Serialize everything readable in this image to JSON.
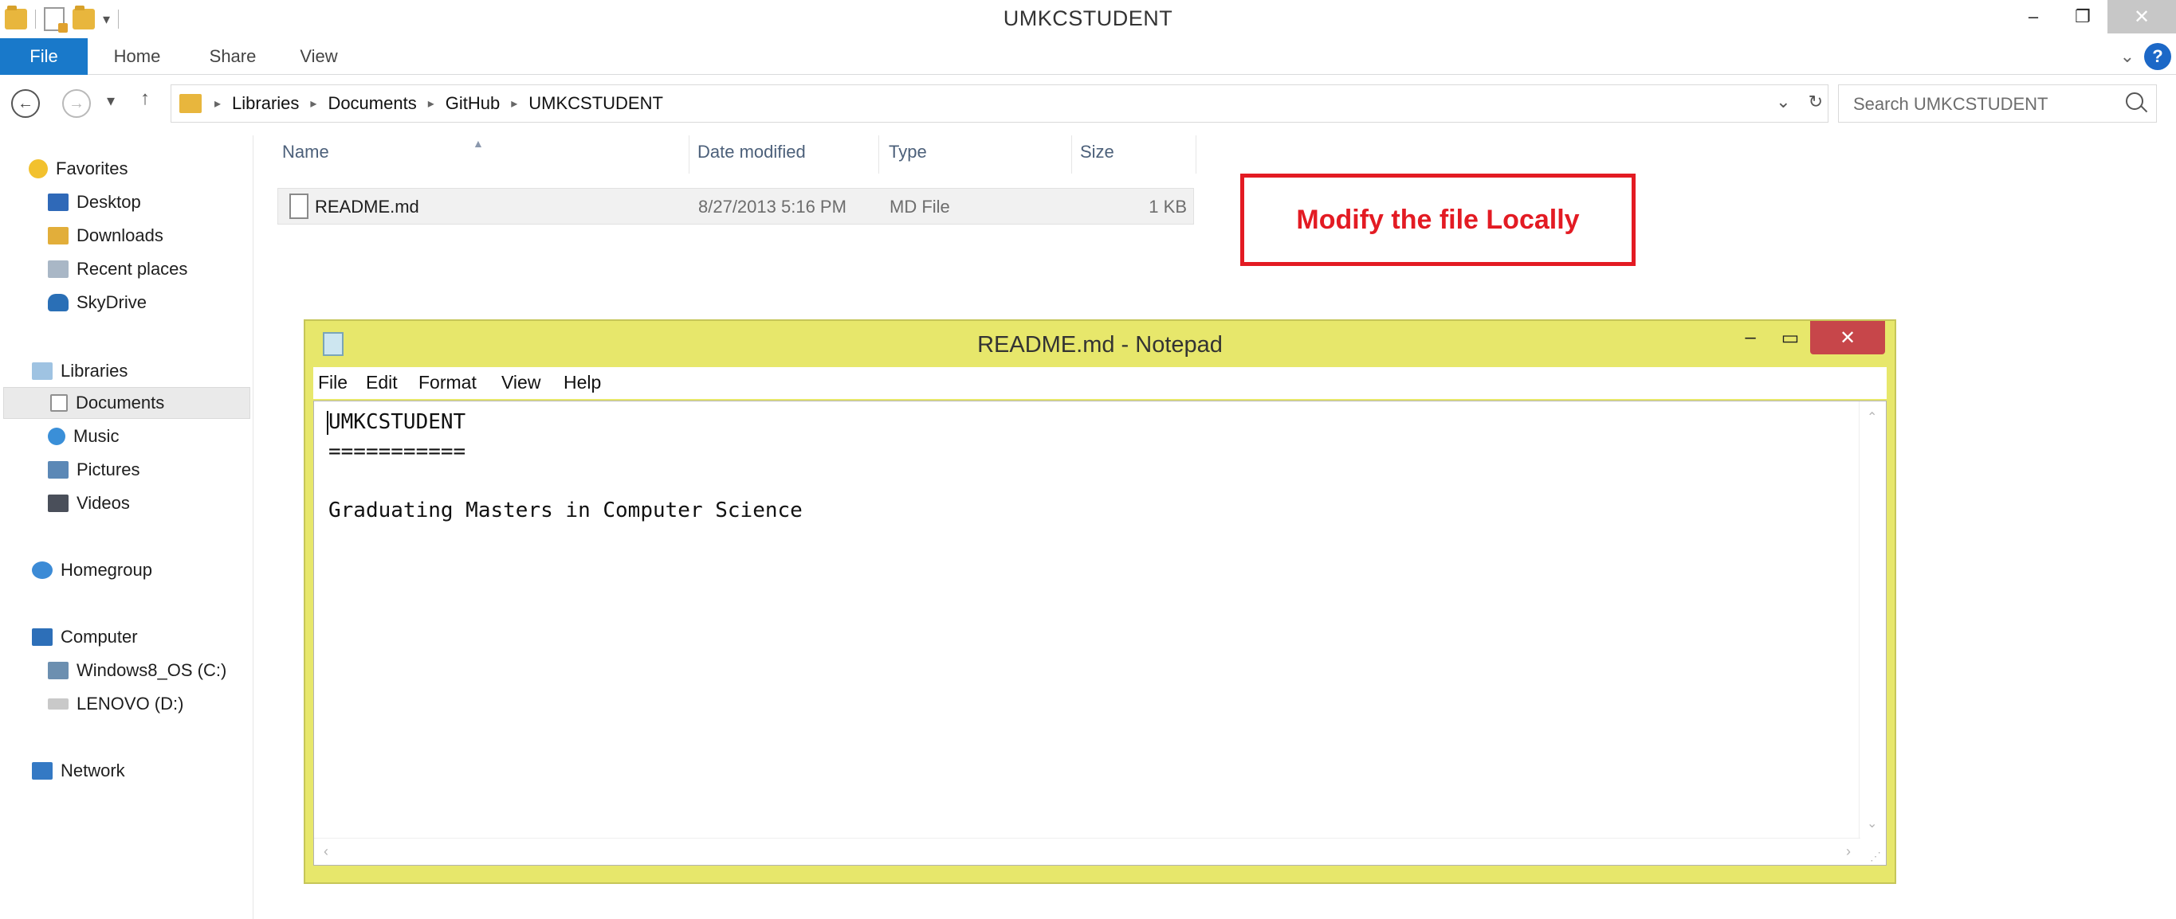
{
  "window": {
    "title": "UMKCSTUDENT"
  },
  "ribbon": {
    "tabs": [
      "File",
      "Home",
      "Share",
      "View"
    ]
  },
  "address": {
    "path": [
      "Libraries",
      "Documents",
      "GitHub",
      "UMKCSTUDENT"
    ],
    "search_placeholder": "Search UMKCSTUDENT"
  },
  "sidebar": {
    "favorites": {
      "label": "Favorites",
      "items": [
        "Desktop",
        "Downloads",
        "Recent places",
        "SkyDrive"
      ]
    },
    "libraries": {
      "label": "Libraries",
      "items": [
        "Documents",
        "Music",
        "Pictures",
        "Videos"
      ]
    },
    "homegroup": {
      "label": "Homegroup"
    },
    "computer": {
      "label": "Computer",
      "items": [
        "Windows8_OS (C:)",
        "LENOVO (D:)"
      ]
    },
    "network": {
      "label": "Network"
    }
  },
  "file_list": {
    "columns": [
      "Name",
      "Date modified",
      "Type",
      "Size"
    ],
    "rows": [
      {
        "name": "README.md",
        "date": "8/27/2013 5:16 PM",
        "type": "MD File",
        "size": "1 KB"
      }
    ]
  },
  "annotation": {
    "text": "Modify the file Locally",
    "color": "#e31b23"
  },
  "notepad": {
    "title": "README.md - Notepad",
    "menu": [
      "File",
      "Edit",
      "Format",
      "View",
      "Help"
    ],
    "content": "UMKCSTUDENT\n===========\n\nGraduating Masters in Computer Science"
  },
  "colors": {
    "accent": "#1979ca",
    "notepad_frame": "#e7e76b",
    "close_button": "#c7464a"
  }
}
